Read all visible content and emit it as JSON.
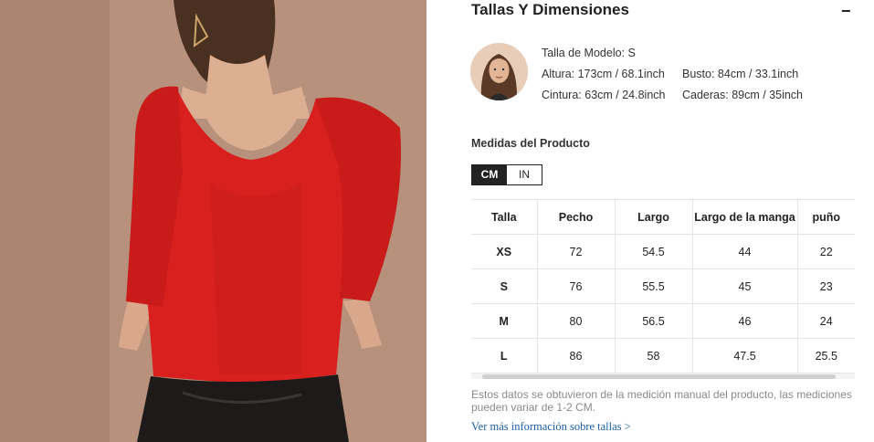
{
  "section": {
    "title": "Tallas Y Dimensiones",
    "collapse_symbol": "−"
  },
  "model": {
    "size": "Talla de Modelo: S",
    "height": "Altura: 173cm / 68.1inch",
    "bust": "Busto: 84cm / 33.1inch",
    "waist": "Cintura: 63cm / 24.8inch",
    "hips": "Caderas: 89cm / 35inch"
  },
  "measurements": {
    "title": "Medidas del Producto",
    "units": [
      "CM",
      "IN"
    ],
    "selected_unit": "CM",
    "headers": [
      "Talla",
      "Pecho",
      "Largo",
      "Largo de la manga",
      "puño"
    ],
    "rows": [
      [
        "XS",
        "72",
        "54.5",
        "44",
        "22"
      ],
      [
        "S",
        "76",
        "55.5",
        "45",
        "23"
      ],
      [
        "M",
        "80",
        "56.5",
        "46",
        "24"
      ],
      [
        "L",
        "86",
        "58",
        "47.5",
        "25.5"
      ]
    ]
  },
  "note": "Estos datos se obtuvieron de la medición manual del producto, las mediciones pueden variar de 1-2 CM.",
  "more_link": "Ver más información sobre tallas >",
  "colors": {
    "garment": "#d8201f",
    "link": "#1a5fa8",
    "toggle_active": "#222222"
  }
}
